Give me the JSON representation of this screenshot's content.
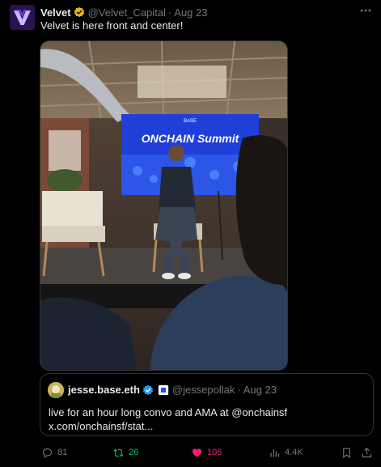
{
  "tweet": {
    "author_name": "Velvet",
    "author_handle": "@Velvet_Capital",
    "separator": "·",
    "date": "Aug 23",
    "text": "Velvet is here front and center!"
  },
  "media": {
    "banner_lines": [
      "ONCHAIN Summit",
      "BASE"
    ]
  },
  "quote": {
    "author_name": "jesse.base.eth",
    "author_handle": "@jessepollak",
    "separator": "·",
    "date": "Aug 23",
    "text_line1": "live for an hour long convo and AMA at @onchainsf",
    "text_line2": "x.com/onchainsf/stat..."
  },
  "actions": {
    "replies": "81",
    "reposts": "26",
    "likes": "106",
    "views": "4.4K"
  },
  "colors": {
    "background": "#000000",
    "text": "#e7e9ea",
    "muted": "#71767b",
    "verified_gold": "#e2b719",
    "verified_blue": "#1d9bf0",
    "repost_green": "#00ba7c",
    "like_pink": "#f91880"
  },
  "icons": {
    "reply": "speech-bubble-icon",
    "repost": "repost-arrows-icon",
    "like": "heart-filled-icon",
    "views": "bar-chart-icon",
    "bookmark": "bookmark-icon",
    "share": "share-upload-icon"
  }
}
